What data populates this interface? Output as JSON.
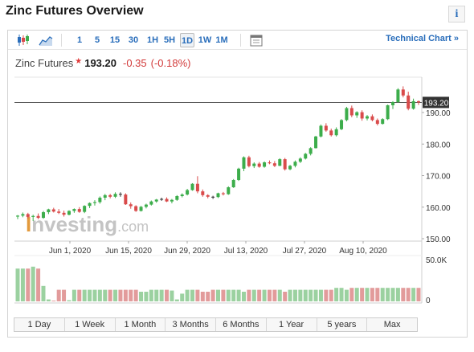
{
  "header": {
    "title": "Zinc Futures Overview",
    "info_label": "i"
  },
  "toolbar": {
    "timeframes": [
      "1",
      "5",
      "15",
      "30",
      "1H",
      "5H",
      "1D",
      "1W",
      "1M"
    ],
    "active_timeframe": "1D",
    "technical_link": "Technical Chart »"
  },
  "quote": {
    "name": "Zinc Futures",
    "price": "193.20",
    "change": "-0.35",
    "change_pct": "(-0.18%)"
  },
  "watermark": {
    "left": "I",
    "right": "nvesting",
    "suffix": ".com"
  },
  "colors": {
    "up": "#3cad4b",
    "down": "#d94b4b",
    "link": "#2a6ebb",
    "vol_up": "#9bd1a0",
    "vol_down": "#e29b9b"
  },
  "chart_data": {
    "type": "candlestick",
    "y_ticks": [
      "150.00",
      "160.00",
      "170.00",
      "180.00",
      "190.00"
    ],
    "ylim": [
      150,
      198
    ],
    "last_price_label": "193.20",
    "last_price": 193.2,
    "x_labels": [
      "Jun 1, 2020",
      "Jun 15, 2020",
      "Jun 29, 2020",
      "Jul 13, 2020",
      "Jul 27, 2020",
      "Aug 10, 2020"
    ],
    "volume_ticks": [
      "50.0K",
      "0"
    ],
    "candles": [
      [
        157,
        157.5,
        156.2,
        157.3
      ],
      [
        157.3,
        158.3,
        156.8,
        157.8
      ],
      [
        157.8,
        158.2,
        156.4,
        156.9
      ],
      [
        156.9,
        157.6,
        155.6,
        157.2
      ],
      [
        157.2,
        158,
        156.2,
        156.6
      ],
      [
        156.6,
        158.8,
        156.3,
        158.4
      ],
      [
        158.4,
        159.5,
        157.8,
        159.3
      ],
      [
        159.3,
        159.8,
        158.3,
        158.6
      ],
      [
        158.6,
        159.4,
        157.8,
        158.2
      ],
      [
        158.2,
        158.9,
        157,
        157.6
      ],
      [
        157.6,
        159,
        157.4,
        158.8
      ],
      [
        158.8,
        159.6,
        158.2,
        159.4
      ],
      [
        159.4,
        160,
        158.2,
        158.5
      ],
      [
        158.5,
        160.6,
        158.1,
        160.4
      ],
      [
        160.4,
        161.5,
        159.7,
        161.3
      ],
      [
        161.3,
        162.2,
        160.5,
        161.6
      ],
      [
        161.6,
        163.4,
        161.1,
        163
      ],
      [
        163,
        164.2,
        162.2,
        163.8
      ],
      [
        163.8,
        164.2,
        162.8,
        163.3
      ],
      [
        163.3,
        164.7,
        162.9,
        164.2
      ],
      [
        164.2,
        164.7,
        163.3,
        164
      ],
      [
        164,
        164.4,
        160.7,
        160.9
      ],
      [
        160.9,
        161.5,
        159.5,
        160.3
      ],
      [
        160.3,
        160.6,
        158.5,
        158.8
      ],
      [
        158.8,
        160.4,
        158.6,
        160.1
      ],
      [
        160.1,
        161.1,
        159.6,
        160.8
      ],
      [
        160.8,
        162.1,
        160.5,
        161.8
      ],
      [
        161.8,
        162.6,
        161.4,
        162.4
      ],
      [
        162.4,
        163,
        162,
        162.6
      ],
      [
        162.6,
        163.1,
        161.6,
        161.8
      ],
      [
        161.8,
        162.6,
        161.2,
        162.3
      ],
      [
        162.3,
        163.8,
        162,
        163.5
      ],
      [
        163.5,
        164.4,
        163.1,
        164
      ],
      [
        164,
        165.8,
        163.7,
        165.4
      ],
      [
        165.4,
        167.6,
        165.2,
        167.4
      ],
      [
        167.4,
        169.8,
        164.4,
        165
      ],
      [
        165,
        165.6,
        163.3,
        163.8
      ],
      [
        163.8,
        164.1,
        162.8,
        163.3
      ],
      [
        163.3,
        163.6,
        162.6,
        163.2
      ],
      [
        163.2,
        164.6,
        162.9,
        164.4
      ],
      [
        164.4,
        164.8,
        163.7,
        164.1
      ],
      [
        164.1,
        166.6,
        163.9,
        166.3
      ],
      [
        166.3,
        168.9,
        166.1,
        168.6
      ],
      [
        168.6,
        172.5,
        168.3,
        172.2
      ],
      [
        172.2,
        176.1,
        171.4,
        175.8
      ],
      [
        175.8,
        176.3,
        172.6,
        173
      ],
      [
        173,
        174.2,
        172.4,
        173.8
      ],
      [
        173.8,
        174.3,
        172.5,
        172.8
      ],
      [
        172.8,
        174.5,
        172.5,
        174.2
      ],
      [
        174.2,
        174.8,
        173.6,
        173.9
      ],
      [
        173.9,
        174.6,
        172.7,
        173.1
      ],
      [
        173.1,
        175.5,
        173,
        175.2
      ],
      [
        175.2,
        175.6,
        171.6,
        172
      ],
      [
        172,
        173.4,
        171.7,
        173.1
      ],
      [
        173.1,
        174.8,
        172.6,
        174.4
      ],
      [
        174.4,
        175.8,
        174,
        175.4
      ],
      [
        175.4,
        177.2,
        175.1,
        176.9
      ],
      [
        176.9,
        179,
        176.4,
        178.7
      ],
      [
        178.7,
        182.6,
        178.6,
        182.4
      ],
      [
        182.4,
        186.2,
        182.1,
        185.8
      ],
      [
        185.8,
        186.6,
        183.9,
        184.3
      ],
      [
        184.3,
        184.9,
        182.4,
        182.8
      ],
      [
        182.8,
        185.3,
        182.4,
        184.7
      ],
      [
        184.7,
        187.9,
        184.4,
        187.6
      ],
      [
        187.6,
        191.8,
        187.2,
        191.4
      ],
      [
        191.4,
        192.2,
        188.5,
        189.1
      ],
      [
        189.1,
        190.4,
        188.3,
        190.1
      ],
      [
        190.1,
        190.7,
        187.4,
        188.1
      ],
      [
        188.1,
        189.2,
        187.5,
        188.8
      ],
      [
        188.8,
        189.4,
        187.2,
        187.6
      ],
      [
        187.6,
        188.1,
        185.9,
        186.4
      ],
      [
        186.4,
        188.2,
        186.2,
        187.9
      ],
      [
        187.9,
        192.5,
        187.6,
        192.3
      ],
      [
        192.3,
        193.6,
        191.1,
        193.3
      ],
      [
        193.3,
        197.7,
        193.1,
        197.3
      ],
      [
        197.3,
        198.3,
        194.8,
        195.4
      ],
      [
        195.4,
        196.6,
        190.7,
        191.2
      ],
      [
        191.2,
        194.4,
        190.9,
        193.6
      ],
      [
        193.6,
        193.8,
        192.4,
        193.2
      ]
    ],
    "volume_ratio": [
      0.85,
      0.85,
      0.85,
      0.9,
      0.85,
      0.4,
      0.05,
      0.02,
      0.3,
      0.3,
      0.03,
      0.3,
      0.3,
      0.3,
      0.3,
      0.3,
      0.3,
      0.3,
      0.3,
      0.3,
      0.3,
      0.3,
      0.3,
      0.3,
      0.25,
      0.25,
      0.3,
      0.3,
      0.3,
      0.3,
      0.28,
      0.05,
      0.2,
      0.3,
      0.3,
      0.3,
      0.25,
      0.25,
      0.3,
      0.3,
      0.3,
      0.3,
      0.3,
      0.3,
      0.25,
      0.3,
      0.3,
      0.3,
      0.3,
      0.3,
      0.3,
      0.3,
      0.25,
      0.3,
      0.3,
      0.3,
      0.3,
      0.3,
      0.3,
      0.3,
      0.3,
      0.3,
      0.35,
      0.35,
      0.3,
      0.35,
      0.35,
      0.35,
      0.35,
      0.35,
      0.35,
      0.35,
      0.35,
      0.35,
      0.35,
      0.35,
      0.35,
      0.35,
      0.35
    ]
  },
  "range_buttons": [
    "1 Day",
    "1 Week",
    "1 Month",
    "3 Months",
    "6 Months",
    "1 Year",
    "5 years",
    "Max"
  ]
}
